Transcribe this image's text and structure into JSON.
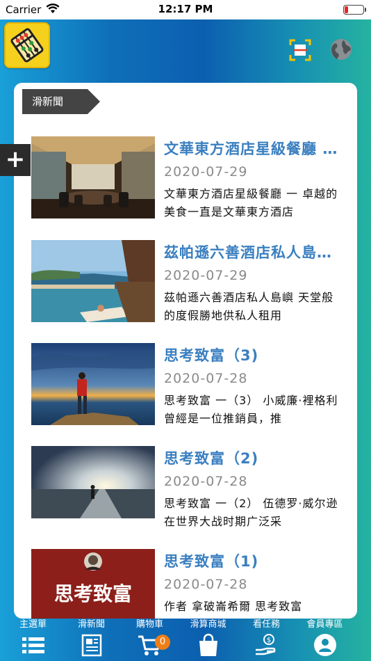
{
  "status_bar": {
    "carrier": "Carrier",
    "time": "12:17 PM"
  },
  "header": {
    "icons": [
      "app-logo",
      "scan-icon",
      "globe-icon"
    ]
  },
  "side_button": {
    "label": "+"
  },
  "section": {
    "tag": "滑新聞"
  },
  "news": [
    {
      "title": "文華東方酒店星級餐廳 一 卓越的美食一直是文華東方酒店",
      "date": "2020-07-29",
      "summary": "文華東方酒店星級餐廳 一 卓越的美食一直是文華東方酒店",
      "image": "restaurant-photo"
    },
    {
      "title": "茲帕遜六善酒店私人島嶼 天堂般的度假勝地供私人租用",
      "date": "2020-07-29",
      "summary": "茲帕遜六善酒店私人島嶼 天堂般的度假勝地供私人租用",
      "image": "island-pool-photo"
    },
    {
      "title": "思考致富（3)",
      "date": "2020-07-28",
      "summary": "思考致富 一（3） 小威廉·裡格利 曾經是一位推銷員，推",
      "image": "man-on-cliff-photo"
    },
    {
      "title": "思考致富（2)",
      "date": "2020-07-28",
      "summary": "思考致富 一（2）  伍德罗·威尔逊在世界大战时期广泛采",
      "image": "man-on-road-photo"
    },
    {
      "title": "思考致富（1)",
      "date": "2020-07-28",
      "summary": "作者 拿破崙希爾 思考致富",
      "image": "book-cover-photo"
    }
  ],
  "tabbar": {
    "tabs": [
      {
        "label": "主選單",
        "icon": "menu-list-icon"
      },
      {
        "label": "滑新聞",
        "icon": "newspaper-icon"
      },
      {
        "label": "購物車",
        "icon": "shopping-cart-icon",
        "badge": "0"
      },
      {
        "label": "滑算商城",
        "icon": "shopping-bag-icon"
      },
      {
        "label": "看任務",
        "icon": "hand-coin-icon"
      },
      {
        "label": "會員專區",
        "icon": "member-avatar-icon"
      }
    ]
  },
  "colors": {
    "title_blue": "#3a7fc0",
    "date_gray": "#8a8a8a",
    "badge_orange": "#f07e16",
    "logo_yellow": "#f5d11e"
  }
}
